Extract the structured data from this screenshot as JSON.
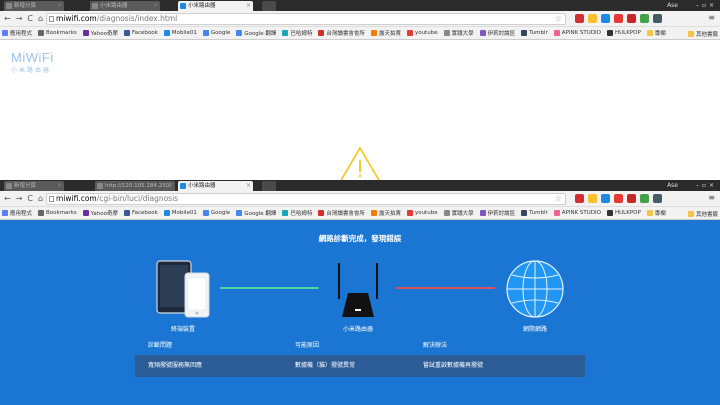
{
  "top_window": {
    "tabs": [
      {
        "label": "新增分頁",
        "active": false
      },
      {
        "label": "小米路由器",
        "active": false
      },
      {
        "label": "小米路由器",
        "active": true
      }
    ],
    "user": "Ase",
    "url_domain": "miwifi.com",
    "url_path": "/diagnosis/index.html"
  },
  "bottom_window": {
    "tabs": [
      {
        "label": "新增分頁",
        "active": false
      },
      {
        "label": "http://120.105.184.250/",
        "active": false
      },
      {
        "label": "小米路由器",
        "active": true
      }
    ],
    "user": "Ase",
    "url_domain": "miwifi.com",
    "url_path": "/cgi-bin/luci/diagnosis"
  },
  "bookmarks": [
    {
      "label": "應用程式",
      "color": "#5c7cfa"
    },
    {
      "label": "Bookmarks",
      "color": "#666666"
    },
    {
      "label": "Yahoo奇摩",
      "color": "#6b2fa3"
    },
    {
      "label": "Facebook",
      "color": "#3b5998"
    },
    {
      "label": "Mobile01",
      "color": "#1e88e5"
    },
    {
      "label": "Google",
      "color": "#4285f4"
    },
    {
      "label": "Google 翻譯",
      "color": "#4285f4"
    },
    {
      "label": "巴哈姆特",
      "color": "#1aa6b7"
    },
    {
      "label": "台灣讀書會會所",
      "color": "#d32f2f"
    },
    {
      "label": "露天拍賣",
      "color": "#f57c00"
    },
    {
      "label": "youtube",
      "color": "#e53935"
    },
    {
      "label": "實踐大學",
      "color": "#888888"
    },
    {
      "label": "伊莉討論區",
      "color": "#7e57c2"
    },
    {
      "label": "Tumblr",
      "color": "#35465c"
    },
    {
      "label": "APINK STUDIO",
      "color": "#f06292"
    },
    {
      "label": "HULKPOP",
      "color": "#333333"
    },
    {
      "label": "專欄",
      "color": "#f4c542"
    }
  ],
  "bookmarks_other": "其他書籤",
  "logo": {
    "text": "MiWiFi",
    "subtitle": "小米路由器"
  },
  "diagnosis": {
    "heading": "網路診斷完成，發現錯誤",
    "devices": [
      {
        "label": "終端裝置",
        "icon": "phone-tablet-icon"
      },
      {
        "label": "小米路由器",
        "icon": "router-icon"
      },
      {
        "label": "網際網路",
        "icon": "globe-icon"
      }
    ],
    "links": [
      {
        "status": "ok",
        "color": "#4cd9a0"
      },
      {
        "status": "error",
        "color": "#e0505a"
      }
    ],
    "table": {
      "headers": [
        "診斷問題",
        "可能原因",
        "解決辦法"
      ],
      "rows": [
        [
          "寬頻撥號服務無回應",
          "數據機（貓）撥號異常",
          "嘗試重啟數據機再撥號"
        ]
      ]
    }
  }
}
